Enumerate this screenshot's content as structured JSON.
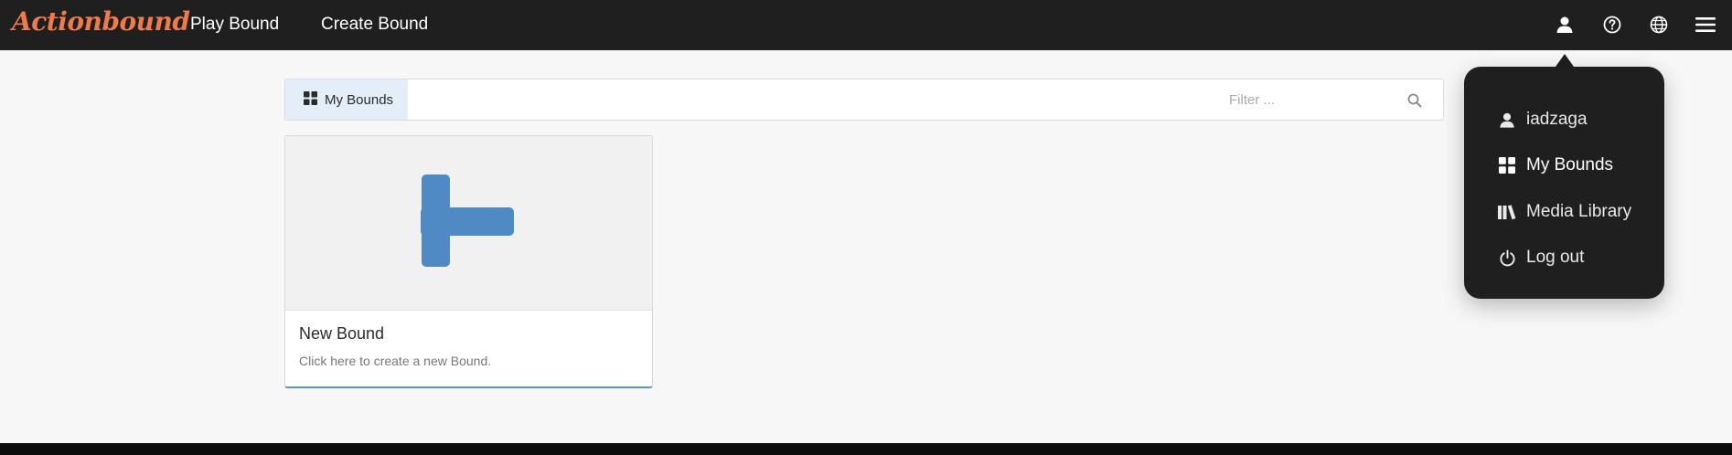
{
  "brand": {
    "logo_text": "Actionbound",
    "color": "#f07a4a"
  },
  "nav": {
    "play_label": "Play Bound",
    "create_label": "Create Bound",
    "icons": [
      "user-icon",
      "help-icon",
      "globe-icon",
      "hamburger-menu-icon"
    ]
  },
  "toolbar": {
    "tab_label": "My Bounds",
    "filter_placeholder": "Filter ...",
    "filter_value": ""
  },
  "card": {
    "title": "New Bound",
    "description": "Click here to create a new Bound.",
    "accent_color": "#4f8ac5"
  },
  "user_menu": {
    "items": [
      {
        "label": "iadzaga",
        "icon": "user-icon"
      },
      {
        "label": "My Bounds",
        "icon": "grid-icon"
      },
      {
        "label": "Media Library",
        "icon": "books-icon"
      },
      {
        "label": "Log out",
        "icon": "power-icon"
      }
    ]
  }
}
